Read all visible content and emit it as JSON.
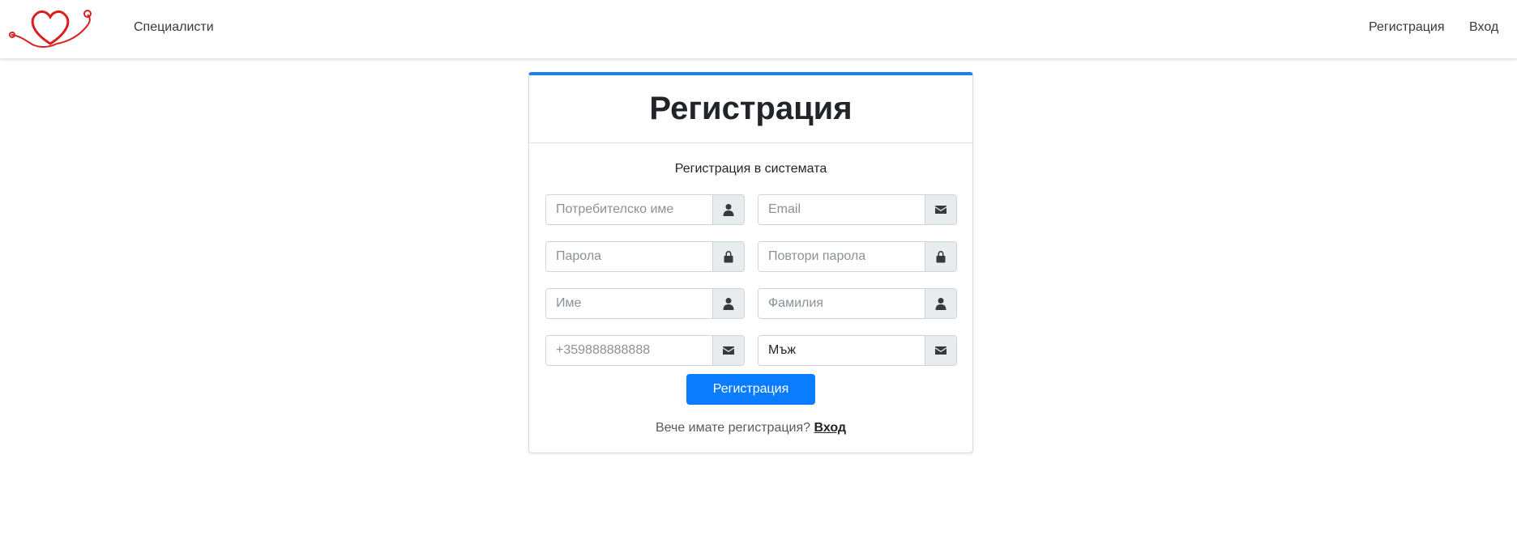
{
  "navbar": {
    "logo_icon": "heart-stethoscope-logo",
    "specialists_label": "Специалисти",
    "register_label": "Регистрация",
    "login_label": "Вход"
  },
  "card": {
    "title": "Регистрация",
    "subtitle": "Регистрация в системата",
    "accent_color": "#1a7ff0"
  },
  "form": {
    "username": {
      "placeholder": "Потребителско име",
      "value": "",
      "icon": "user-icon"
    },
    "email": {
      "placeholder": "Email",
      "value": "",
      "icon": "envelope-icon"
    },
    "password": {
      "placeholder": "Парола",
      "value": "",
      "icon": "lock-icon"
    },
    "repeat_password": {
      "placeholder": "Повтори парола",
      "value": "",
      "icon": "lock-icon"
    },
    "first_name": {
      "placeholder": "Име",
      "value": "",
      "icon": "user-icon"
    },
    "last_name": {
      "placeholder": "Фамилия",
      "value": "",
      "icon": "user-icon"
    },
    "phone": {
      "placeholder": "+359888888888",
      "value": "",
      "icon": "envelope-icon"
    },
    "gender": {
      "placeholder": "",
      "value": "Мъж",
      "icon": "envelope-icon"
    },
    "submit_label": "Регистрация",
    "submit_color": "#0a7cff"
  },
  "footer": {
    "prompt_text": "Вече имате регистрация?",
    "login_link": "Вход"
  }
}
